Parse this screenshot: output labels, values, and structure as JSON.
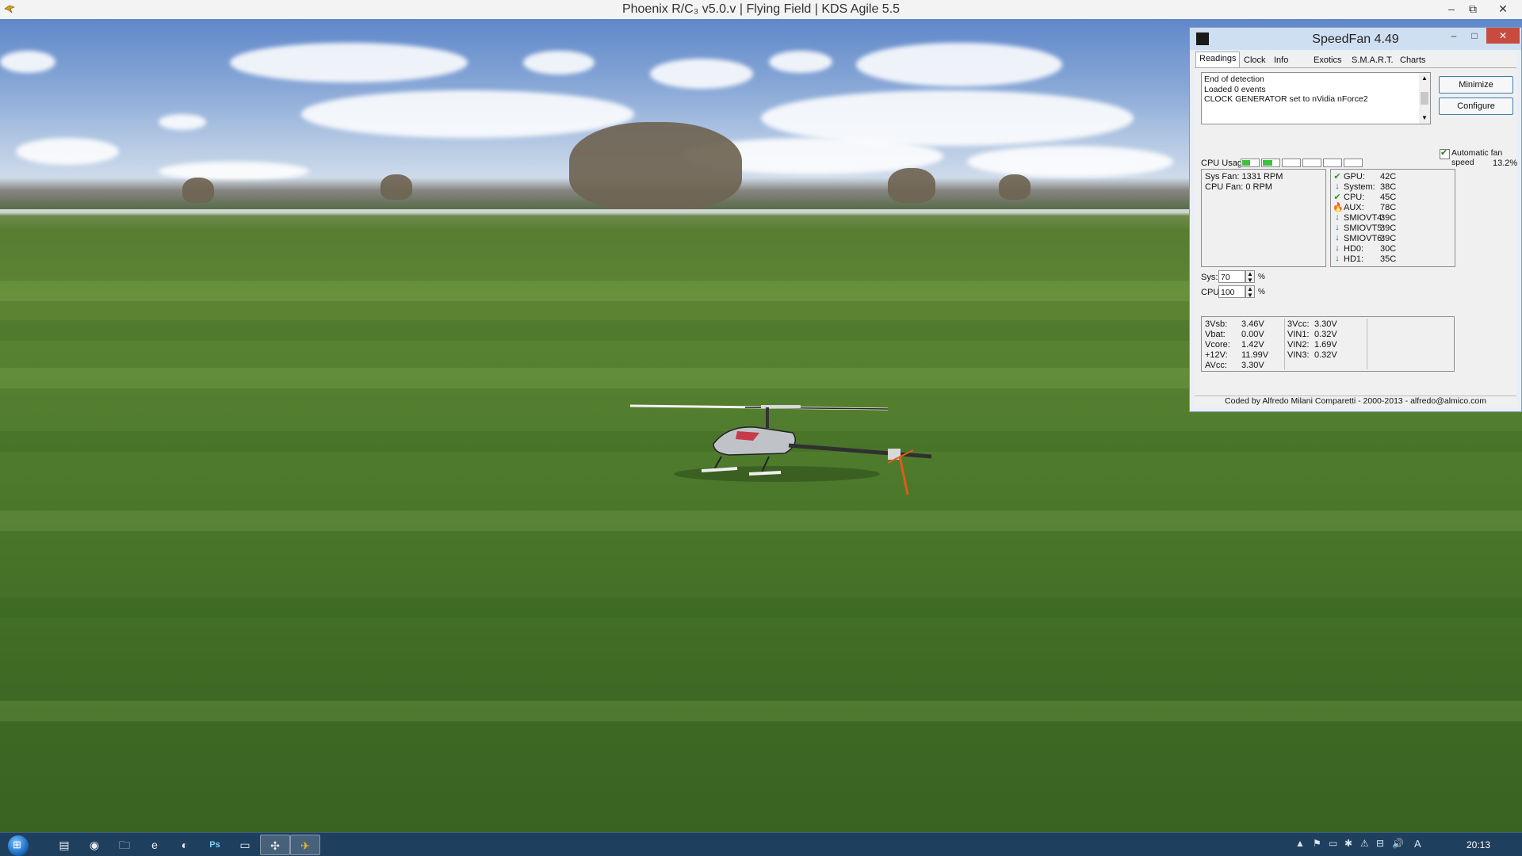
{
  "main_window": {
    "title": "Phoenix R/C₃ v5.0.v  |  Flying Field  |  KDS Agile 5.5",
    "controls": {
      "minimize": "–",
      "restore": "⧉",
      "close": "✕"
    }
  },
  "speedfan": {
    "title": "SpeedFan 4.49",
    "controls": {
      "minimize": "–",
      "maximize": "□",
      "close": "✕"
    },
    "tabs": [
      "Readings",
      "Clock",
      "Info",
      "Exotics",
      "S.M.A.R.T.",
      "Charts"
    ],
    "active_tab": "Readings",
    "log_lines": [
      "End of detection",
      "Loaded 0 events",
      "CLOCK GENERATOR set to nVidia nForce2"
    ],
    "buttons": {
      "minimize": "Minimize",
      "configure": "Configure"
    },
    "auto_fan_label": "Automatic fan speed",
    "auto_fan_checked": true,
    "cpu_usage_label": "CPU Usage",
    "cpu_usage_value": "13.2%",
    "cpu_core_levels": [
      0.5,
      0.6,
      0,
      0,
      0,
      0
    ],
    "fans": [
      "Sys Fan: 1331 RPM",
      "CPU Fan: 0 RPM"
    ],
    "temps": [
      {
        "name": "GPU:",
        "value": "42C",
        "icon": "check-green"
      },
      {
        "name": "System:",
        "value": "38C",
        "icon": "arrow-down-blue"
      },
      {
        "name": "CPU:",
        "value": "45C",
        "icon": "check-green"
      },
      {
        "name": "AUX:",
        "value": "78C",
        "icon": "flame"
      },
      {
        "name": "SMIOVT4:",
        "value": "39C",
        "icon": "arrow-down-blue"
      },
      {
        "name": "SMIOVT5:",
        "value": "39C",
        "icon": "arrow-down-blue"
      },
      {
        "name": "SMIOVT6:",
        "value": "39C",
        "icon": "arrow-down-blue"
      },
      {
        "name": "HD0:",
        "value": "30C",
        "icon": "arrow-down-blue"
      },
      {
        "name": "HD1:",
        "value": "35C",
        "icon": "arrow-down-blue"
      }
    ],
    "speeds": {
      "sys_label": "Sys:",
      "sys_value": "70",
      "cpu_label": "CPU:",
      "cpu_value": "100",
      "pct": "%"
    },
    "voltages_left": [
      {
        "name": "3Vsb:",
        "value": "3.46V"
      },
      {
        "name": "Vbat:",
        "value": "0.00V"
      },
      {
        "name": "Vcore:",
        "value": "1.42V"
      },
      {
        "name": "+12V:",
        "value": "11.99V"
      },
      {
        "name": "AVcc:",
        "value": "3.30V"
      }
    ],
    "voltages_right": [
      {
        "name": "3Vcc:",
        "value": "3.30V"
      },
      {
        "name": "VIN1:",
        "value": "0.32V"
      },
      {
        "name": "VIN2:",
        "value": "1.69V"
      },
      {
        "name": "VIN3:",
        "value": "0.32V"
      }
    ],
    "credit": "Coded by Alfredo Milani Comparetti - 2000-2013 - alfredo@almico.com"
  },
  "taskbar": {
    "pinned": [
      "file-manager-icon",
      "media-player-icon",
      "folder-icon",
      "internet-explorer-icon",
      "firefox-icon",
      "photoshop-icon",
      "terminal-icon",
      "speedfan-icon",
      "phoenix-rc-icon"
    ],
    "active": [
      "speedfan-icon"
    ],
    "ps_label": "Ps",
    "tray_ime": "A",
    "clock": "20:13"
  }
}
